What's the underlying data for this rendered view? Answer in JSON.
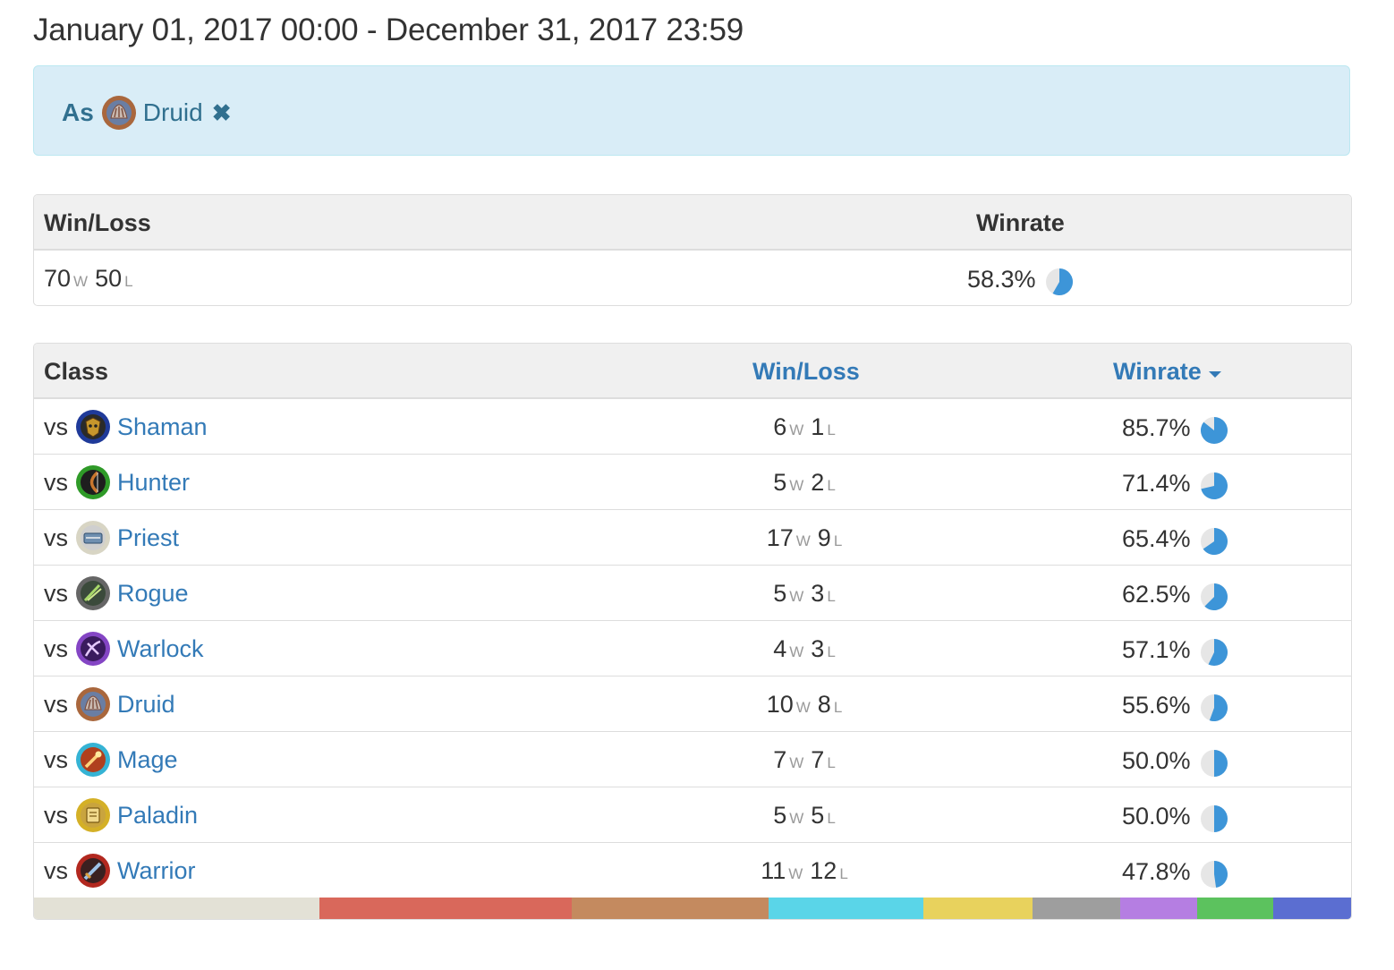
{
  "header": {
    "title": "January 01, 2017 00:00 - December 31, 2017 23:59"
  },
  "filter": {
    "prefix": "As",
    "class_name": "Druid",
    "remove_label": "✖"
  },
  "summary": {
    "col_winloss": "Win/Loss",
    "col_winrate": "Winrate",
    "wins": "70",
    "wins_suffix": "W",
    "losses": "50",
    "losses_suffix": "L",
    "winrate": "58.3%",
    "winrate_fraction": 0.583
  },
  "matchups": {
    "col_class": "Class",
    "col_winloss": "Win/Loss",
    "col_winrate": "Winrate",
    "vs_label": "vs",
    "win_suffix": "W",
    "loss_suffix": "L",
    "rows": [
      {
        "class": "Shaman",
        "wins": "6",
        "losses": "1",
        "winrate": "85.7%",
        "fraction": 0.857,
        "icon": "shaman-icon",
        "color": "#2b4aa8"
      },
      {
        "class": "Hunter",
        "wins": "5",
        "losses": "2",
        "winrate": "71.4%",
        "fraction": 0.714,
        "icon": "hunter-icon",
        "color": "#3a9c2e"
      },
      {
        "class": "Priest",
        "wins": "17",
        "losses": "9",
        "winrate": "65.4%",
        "fraction": 0.654,
        "icon": "priest-icon",
        "color": "#d9d6c6"
      },
      {
        "class": "Rogue",
        "wins": "5",
        "losses": "3",
        "winrate": "62.5%",
        "fraction": 0.625,
        "icon": "rogue-icon",
        "color": "#777777"
      },
      {
        "class": "Warlock",
        "wins": "4",
        "losses": "3",
        "winrate": "57.1%",
        "fraction": 0.571,
        "icon": "warlock-icon",
        "color": "#8a4fc7"
      },
      {
        "class": "Druid",
        "wins": "10",
        "losses": "8",
        "winrate": "55.6%",
        "fraction": 0.556,
        "icon": "druid-icon",
        "color": "#a9673d"
      },
      {
        "class": "Mage",
        "wins": "7",
        "losses": "7",
        "winrate": "50.0%",
        "fraction": 0.5,
        "icon": "mage-icon",
        "color": "#3fb9d6"
      },
      {
        "class": "Paladin",
        "wins": "5",
        "losses": "5",
        "winrate": "50.0%",
        "fraction": 0.5,
        "icon": "paladin-icon",
        "color": "#d9b52a"
      },
      {
        "class": "Warrior",
        "wins": "11",
        "losses": "12",
        "winrate": "47.8%",
        "fraction": 0.478,
        "icon": "warrior-icon",
        "color": "#b83228"
      }
    ]
  },
  "colors": {
    "accent": "#337ab7",
    "pie_fill": "#3d95d8",
    "pie_bg": "#e6e6e6",
    "alert_bg": "#d9edf7",
    "alert_text": "#31708f"
  },
  "distribution_bar": [
    {
      "color": "#e3e1d6",
      "share": 0.217
    },
    {
      "color": "#d9685b",
      "share": 0.191
    },
    {
      "color": "#c48a5f",
      "share": 0.15
    },
    {
      "color": "#5ad5e8",
      "share": 0.117
    },
    {
      "color": "#e8d25d",
      "share": 0.083
    },
    {
      "color": "#9e9e9e",
      "share": 0.067
    },
    {
      "color": "#b57ee2",
      "share": 0.058
    },
    {
      "color": "#5cc25e",
      "share": 0.058
    },
    {
      "color": "#5b6ed1",
      "share": 0.059
    }
  ]
}
